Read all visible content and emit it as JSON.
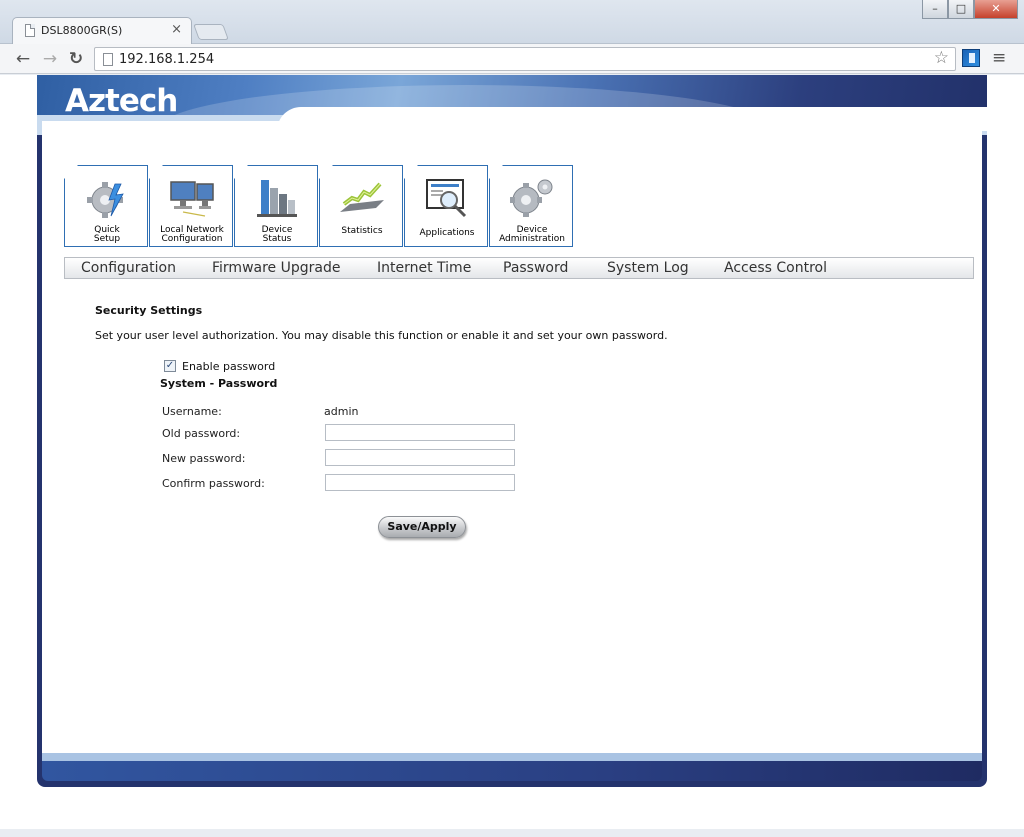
{
  "browser": {
    "tab_title": "DSL8800GR(S)",
    "tab_close": "×",
    "url": "192.168.1.254",
    "window_min": "–",
    "window_max": "□",
    "window_close": "✕",
    "back_glyph": "←",
    "forward_glyph": "→",
    "reload_glyph": "↻",
    "star_glyph": "☆",
    "menu_glyph": "≡"
  },
  "brand": {
    "logo": "Aztech"
  },
  "main_menu": [
    {
      "line1": "Quick",
      "line2": "Setup",
      "icon": "gear-lightning-icon"
    },
    {
      "line1": "Local Network",
      "line2": "Configuration",
      "icon": "monitors-icon"
    },
    {
      "line1": "Device",
      "line2": "Status",
      "icon": "buildings-chart-icon"
    },
    {
      "line1": "Statistics",
      "line2": "",
      "icon": "statistics-graph-icon"
    },
    {
      "line1": "Applications",
      "line2": "",
      "icon": "magnifier-screen-icon"
    },
    {
      "line1": "Device",
      "line2": "Administration",
      "icon": "gears-icon"
    }
  ],
  "sub_menu": [
    "Configuration",
    "Firmware Upgrade",
    "Internet Time",
    "Password",
    "System Log",
    "Access Control"
  ],
  "form": {
    "section_title": "Security Settings",
    "description": "Set your user level authorization. You may disable this function or enable it and set your own password.",
    "enable_password_label": "Enable password",
    "enable_password_checked": true,
    "check_glyph": "✓",
    "system_password_title": "System - Password",
    "username_label": "Username:",
    "username_value": "admin",
    "old_password_label": "Old password:",
    "new_password_label": "New password:",
    "confirm_password_label": "Confirm password:",
    "old_password_value": "",
    "new_password_value": "",
    "confirm_password_value": "",
    "save_label": "Save/Apply"
  },
  "colors": {
    "frame_navy": "#24336d",
    "tile_border": "#2f6fb3",
    "header_light_blue": "#7aa6d8"
  }
}
